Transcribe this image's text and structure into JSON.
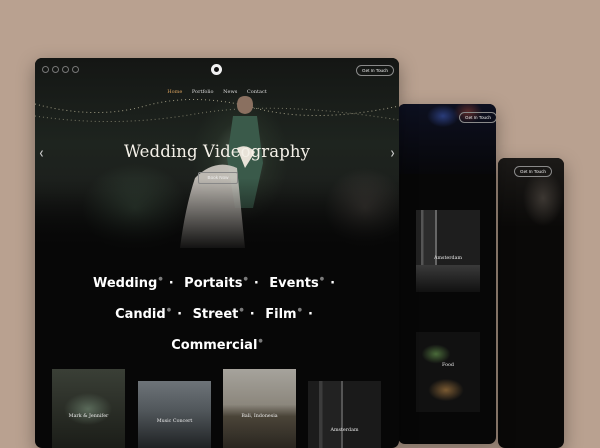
{
  "back_window": {
    "cta": "Get In Touch"
  },
  "middle_window": {
    "cta": "Get In Touch",
    "tiles": [
      {
        "caption": "Amsterdam"
      },
      {
        "caption": "Food"
      }
    ]
  },
  "front_window": {
    "nav": {
      "items": [
        "Home",
        "Portfolio",
        "News",
        "Contact"
      ],
      "active": "Home"
    },
    "cta": "Get In Touch",
    "hero": {
      "title": "Wedding Videography",
      "button": "Book Now"
    },
    "categories": [
      "Wedding",
      "Portaits",
      "Events",
      "Candid",
      "Street",
      "Film",
      "Commercial"
    ],
    "portfolio": [
      {
        "caption": "Mark & Jennifer"
      },
      {
        "caption": "Music Concert"
      },
      {
        "caption": "Bali, Indonesia"
      },
      {
        "caption": "Amsterdam"
      }
    ]
  },
  "icons": {
    "social": [
      "facebook-icon",
      "instagram-icon",
      "twitter-icon",
      "youtube-icon"
    ],
    "logo": "camera-logo-icon",
    "prev": "chevron-left-icon",
    "next": "chevron-right-icon"
  },
  "colors": {
    "background": "#b9a190",
    "window": "#070707",
    "nav_active": "#d8a15e",
    "text": "#f4f0e8"
  }
}
